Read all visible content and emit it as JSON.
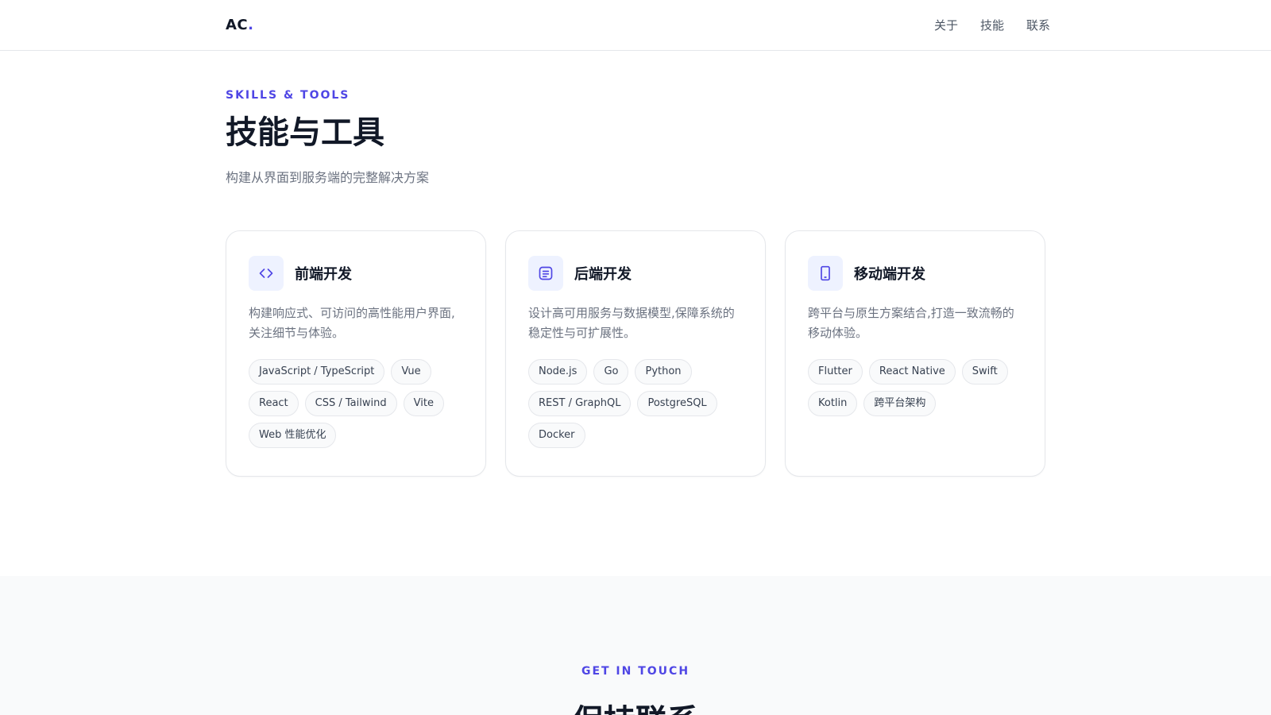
{
  "header": {
    "logo_text": "AC",
    "logo_dot": ".",
    "nav": [
      "关于",
      "技能",
      "联系"
    ]
  },
  "skills": {
    "eyebrow": "SKILLS & TOOLS",
    "title": "技能与工具",
    "subtitle": "构建从界面到服务端的完整解决方案",
    "cards": [
      {
        "icon": "code-icon",
        "title": "前端开发",
        "description": "构建响应式、可访问的高性能用户界面,关注细节与体验。",
        "tags": [
          "JavaScript / TypeScript",
          "Vue",
          "React",
          "CSS / Tailwind",
          "Vite",
          "Web 性能优化"
        ]
      },
      {
        "icon": "server-icon",
        "title": "后端开发",
        "description": "设计高可用服务与数据模型,保障系统的稳定性与可扩展性。",
        "tags": [
          "Node.js",
          "Go",
          "Python",
          "REST / GraphQL",
          "PostgreSQL",
          "Docker"
        ]
      },
      {
        "icon": "mobile-icon",
        "title": "移动端开发",
        "description": "跨平台与原生方案结合,打造一致流畅的移动体验。",
        "tags": [
          "Flutter",
          "React Native",
          "Swift",
          "Kotlin",
          "跨平台架构"
        ]
      }
    ]
  },
  "contact": {
    "eyebrow": "GET IN TOUCH",
    "title": "保持联系"
  },
  "colors": {
    "accent": "#4f46e5",
    "icon_bg": "#eef2ff",
    "section_bg": "#f9fafb"
  }
}
